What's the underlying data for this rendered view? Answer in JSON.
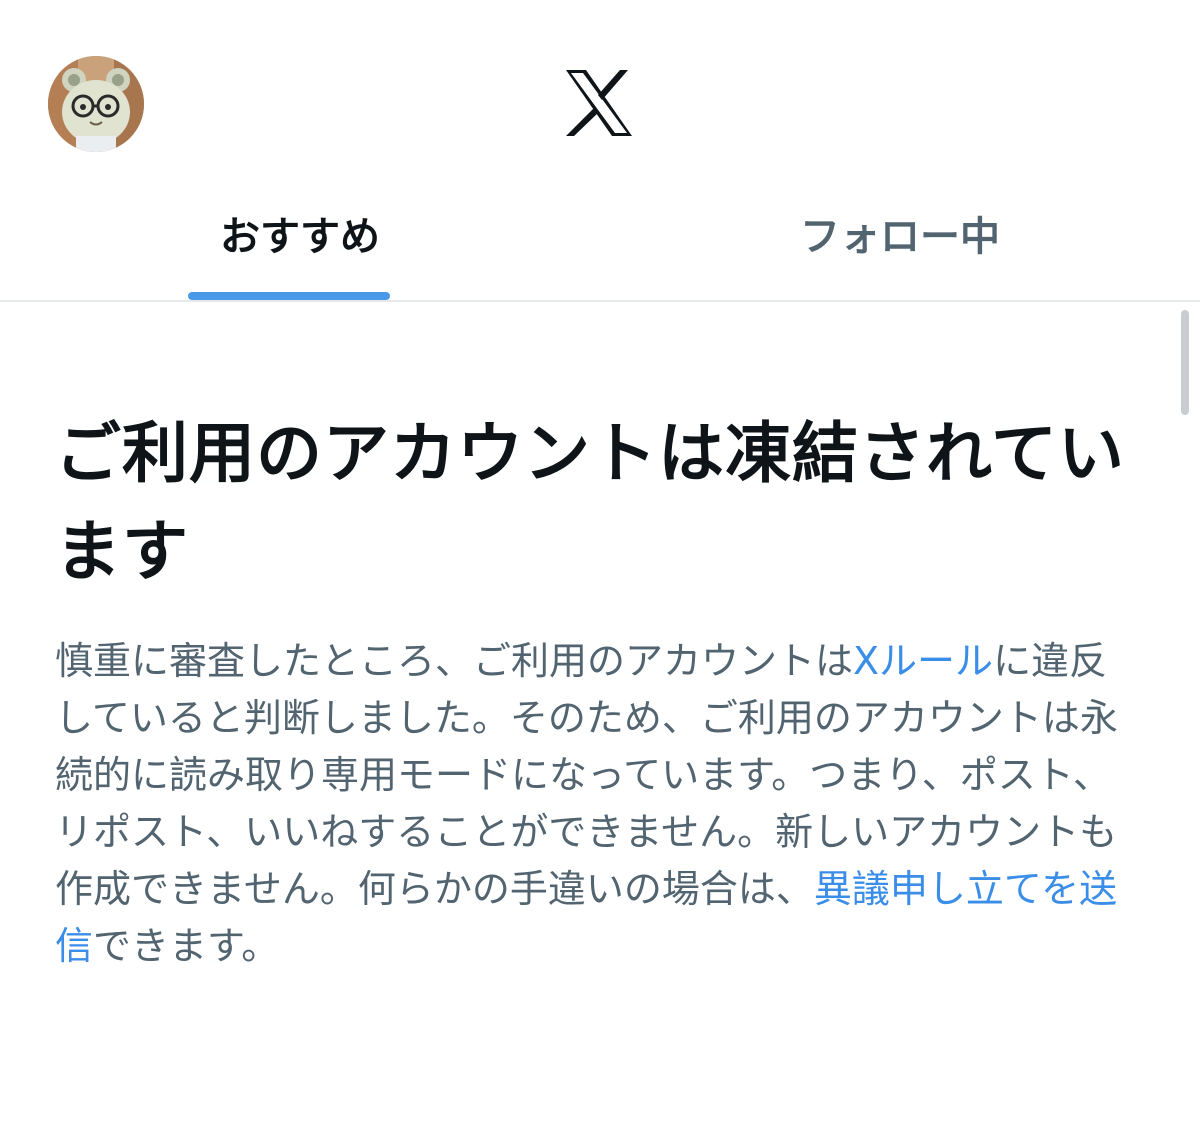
{
  "header": {
    "logo": "x-logo",
    "avatar": "profile-avatar"
  },
  "tabs": [
    {
      "label": "おすすめ",
      "selected": true
    },
    {
      "label": "フォロー中",
      "selected": false
    }
  ],
  "notice": {
    "title": "ご利用のアカウントは凍結されています",
    "body_part1": "慎重に審査したところ、ご利用のアカウントは",
    "rules_link": "Xルール",
    "body_part2": "に違反していると判断しました。そのため、ご利用のアカウントは永続的に読み取り専用モードになっています。つまり、ポスト、リポスト、いいねすることができません。新しいアカウントも作成できません。何らかの手違いの場合は、",
    "appeal_link": "異議申し立てを送信",
    "body_part3": "できます。"
  },
  "colors": {
    "accent": "#4a99e9",
    "link": "#3b8ee8",
    "text_primary": "#0f1419",
    "text_secondary": "#536471"
  }
}
